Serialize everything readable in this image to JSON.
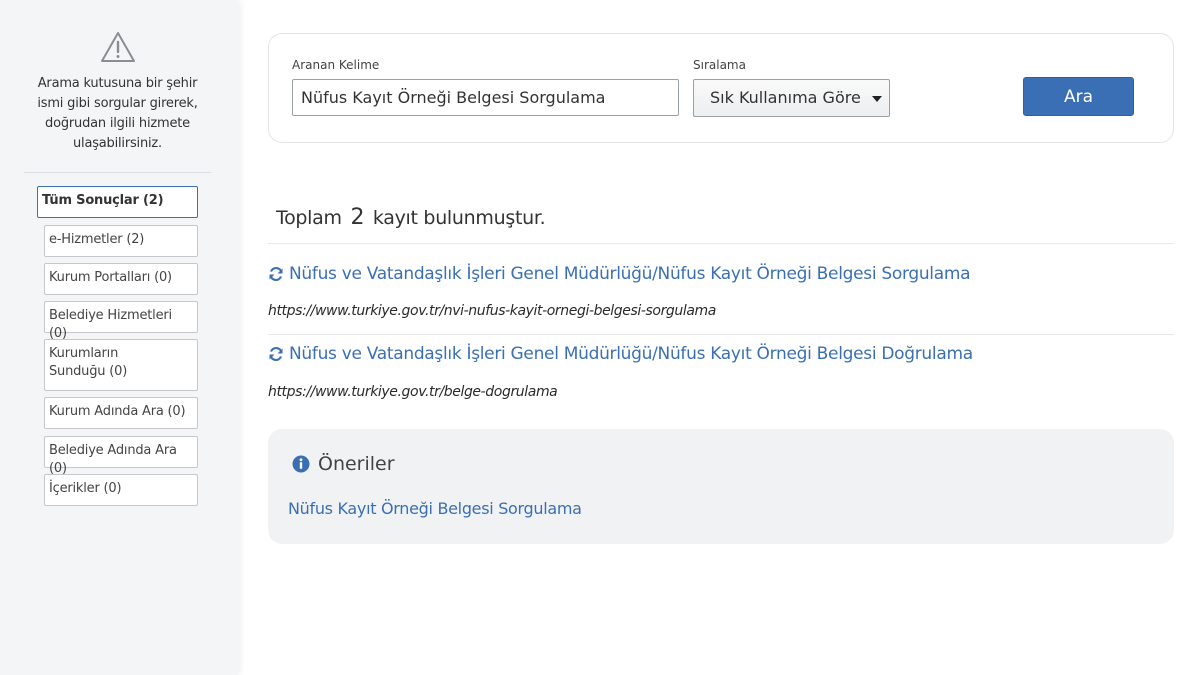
{
  "sidebar": {
    "warning_icon": "warning-triangle-icon",
    "warning_text": "Arama kutusuna bir şehir ismi gibi sorgular girerek, doğrudan ilgili hizmete ulaşabilirsiniz.",
    "filters": [
      {
        "label": "Tüm Sonuçlar (2)",
        "active": true
      },
      {
        "label": "e-Hizmetler (2)",
        "active": false
      },
      {
        "label": "Kurum Portalları (0)",
        "active": false
      },
      {
        "label": "Belediye Hizmetleri (0)",
        "active": false
      },
      {
        "label": "Kurumların Sunduğu (0)",
        "active": false
      },
      {
        "label": "Kurum Adında Ara (0)",
        "active": false
      },
      {
        "label": "Belediye Adında Ara (0)",
        "active": false
      },
      {
        "label": "İçerikler (0)",
        "active": false
      }
    ]
  },
  "search": {
    "keyword_label": "Aranan Kelime",
    "keyword_value": "Nüfus Kayıt Örneği Belgesi Sorgulama",
    "sort_label": "Sıralama",
    "sort_value": "Sık Kullanıma Göre",
    "button_label": "Ara"
  },
  "results": {
    "count_prefix": "Toplam",
    "count": "2",
    "count_suffix": "kayıt bulunmuştur.",
    "items": [
      {
        "title": "Nüfus ve Vatandaşlık İşleri Genel Müdürlüğü/Nüfus Kayıt Örneği Belgesi Sorgulama",
        "url": "https://www.turkiye.gov.tr/nvi-nufus-kayit-ornegi-belgesi-sorgulama",
        "icon": "refresh-icon"
      },
      {
        "title": "Nüfus ve Vatandaşlık İşleri Genel Müdürlüğü/Nüfus Kayıt Örneği Belgesi Doğrulama",
        "url": "https://www.turkiye.gov.tr/belge-dogrulama",
        "icon": "refresh-icon"
      }
    ]
  },
  "suggestions": {
    "heading": "Öneriler",
    "icon": "info-icon",
    "links": [
      "Nüfus Kayıt Örneği Belgesi Sorgulama"
    ]
  },
  "colors": {
    "accent": "#3a6fb5",
    "sidebar_bg": "#f4f5f7",
    "suggest_bg": "#f1f2f4"
  }
}
